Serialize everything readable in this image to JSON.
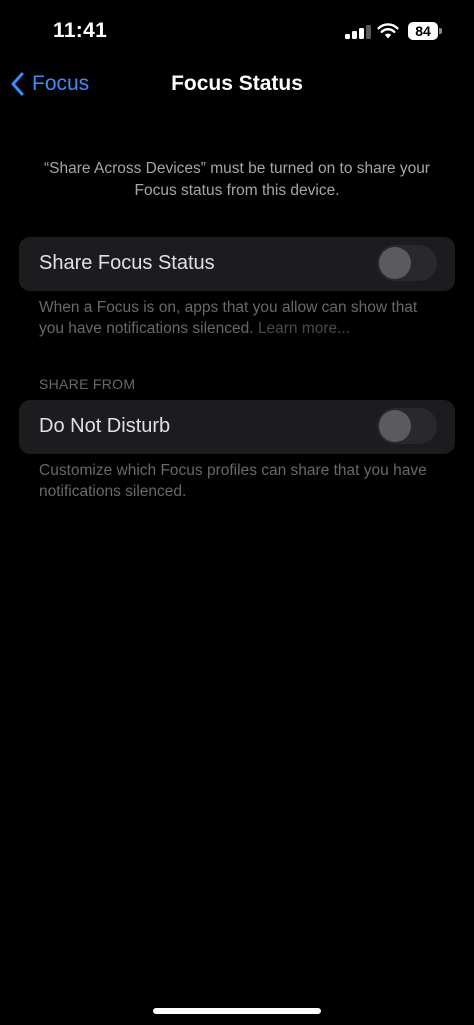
{
  "status_bar": {
    "time": "11:41",
    "battery": "84",
    "signal_bars": 3,
    "signal_icon": "cellular-signal-icon",
    "wifi_icon": "wifi-icon"
  },
  "nav": {
    "back_label": "Focus",
    "back_icon": "chevron-left-icon",
    "title": "Focus Status"
  },
  "info_text": "“Share Across Devices” must be turned on to share your Focus status from this device.",
  "share_focus": {
    "label": "Share Focus Status",
    "enabled": false,
    "footer": "When a Focus is on, apps that you allow can show that you have notifications silenced.",
    "learn_more": "Learn more..."
  },
  "share_from": {
    "header": "SHARE FROM",
    "label": "Do Not Disturb",
    "enabled": false,
    "footer": "Customize which Focus profiles can share that you have notifications silenced."
  },
  "colors": {
    "background": "#000000",
    "accent": "#3b8cff",
    "cell": "#1c1c1e",
    "secondary_text": "#a5a5aa",
    "dim_text": "#68686d"
  }
}
